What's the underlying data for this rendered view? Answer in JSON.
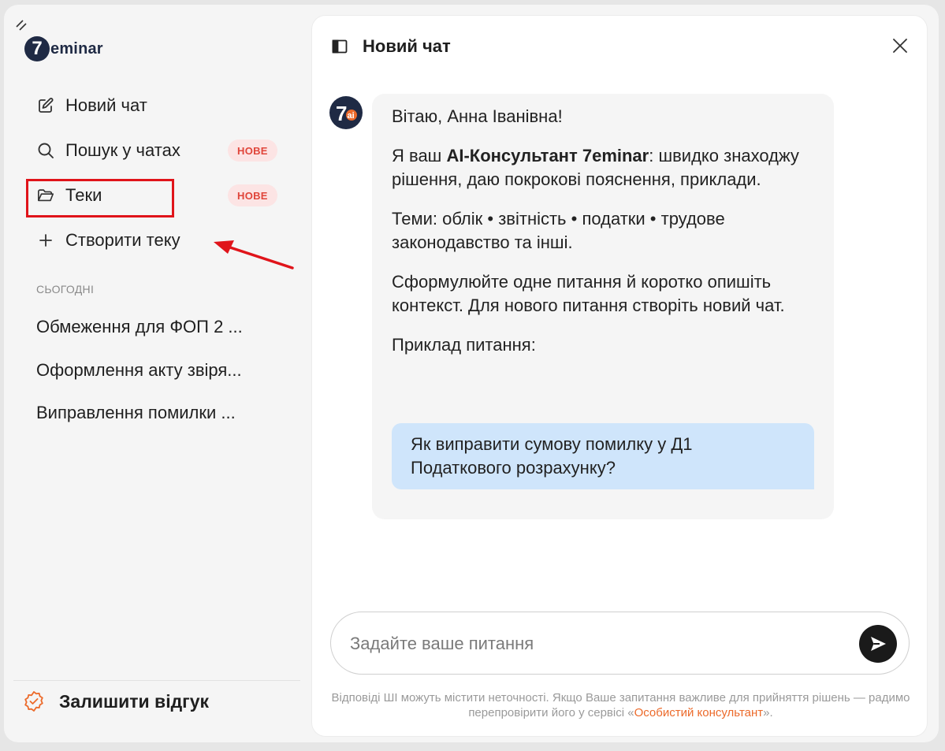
{
  "sidebar": {
    "logo_number": "7",
    "logo_text": "eminar",
    "new_chat": "Новий чат",
    "search": "Пошук у чатах",
    "search_badge": "НОВЕ",
    "folders": "Теки",
    "folders_badge": "НОВЕ",
    "create_folder": "Створити теку",
    "section_today": "СЬОГОДНІ",
    "history": [
      "Обмеження для ФОП 2 ...",
      "Оформлення акту звіря...",
      "Виправлення помилки ..."
    ],
    "feedback": "Залишити відгук"
  },
  "main": {
    "title": "Новий чат",
    "avatar_number": "7",
    "avatar_ai": "ai",
    "greeting": "Вітаю, Анна Іванівна!",
    "intro_prefix": "Я ваш ",
    "intro_bold": "AI-Консультант 7eminar",
    "intro_suffix": ": швидко знаходжу рішення, даю покрокові пояснення, приклади.",
    "topics": "Теми: облік • звітність • податки • трудове законодавство та інші.",
    "instructions": "Сформулюйте одне питання й коротко опишіть контекст. Для нового питання створіть новий чат.",
    "example_label": "Приклад питання:",
    "example_question": "Як виправити сумову помилку у Д1 Податкового розрахунку?",
    "input_placeholder": "Задайте ваше питання",
    "disclaimer_text": "Відповіді ШІ можуть містити неточності. Якщо Ваше запитання важливе для прийняття рішень — радимо перепровірити його у сервісі «",
    "disclaimer_link": "Особистий консультант",
    "disclaimer_end": "»."
  },
  "colors": {
    "accent": "#ec6a2a",
    "badge_bg": "#fce4e4",
    "badge_text": "#e0453a",
    "highlight": "#e0141a",
    "example_bg": "#cfe5fb"
  }
}
